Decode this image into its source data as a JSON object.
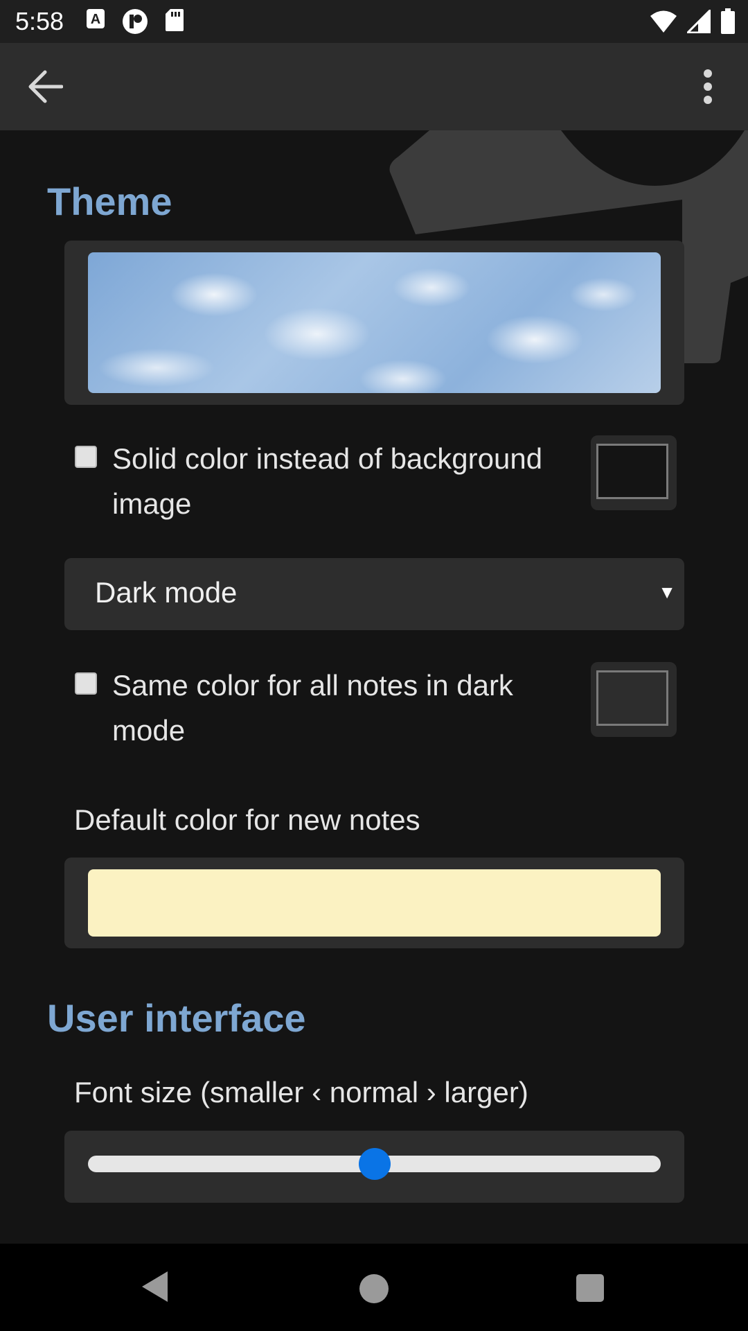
{
  "status_bar": {
    "time": "5:58",
    "notification_icons": [
      "a-icon",
      "p-icon",
      "sd-card-icon"
    ],
    "system_icons": [
      "wifi-icon",
      "signal-icon",
      "battery-icon"
    ]
  },
  "app_bar": {
    "back_icon": "arrow-back-icon",
    "menu_icon": "more-vert-icon"
  },
  "theme": {
    "title": "Theme",
    "solid_color_label": "Solid color instead of background image",
    "solid_color_checked": false,
    "solid_color_swatch": "#141414",
    "mode_dropdown_value": "Dark mode",
    "same_color_label": "Same color for all notes in dark mode",
    "same_color_checked": false,
    "same_color_swatch": "#2d2d2d",
    "default_color_label": "Default color for new notes",
    "default_color": "#fbf2c2"
  },
  "user_interface": {
    "title": "User interface",
    "font_size_label": "Font size (smaller ‹ normal › larger)",
    "font_size_position": 0.5
  },
  "colors": {
    "accent": "#7ea7d2",
    "slider_thumb": "#0a74e6"
  }
}
